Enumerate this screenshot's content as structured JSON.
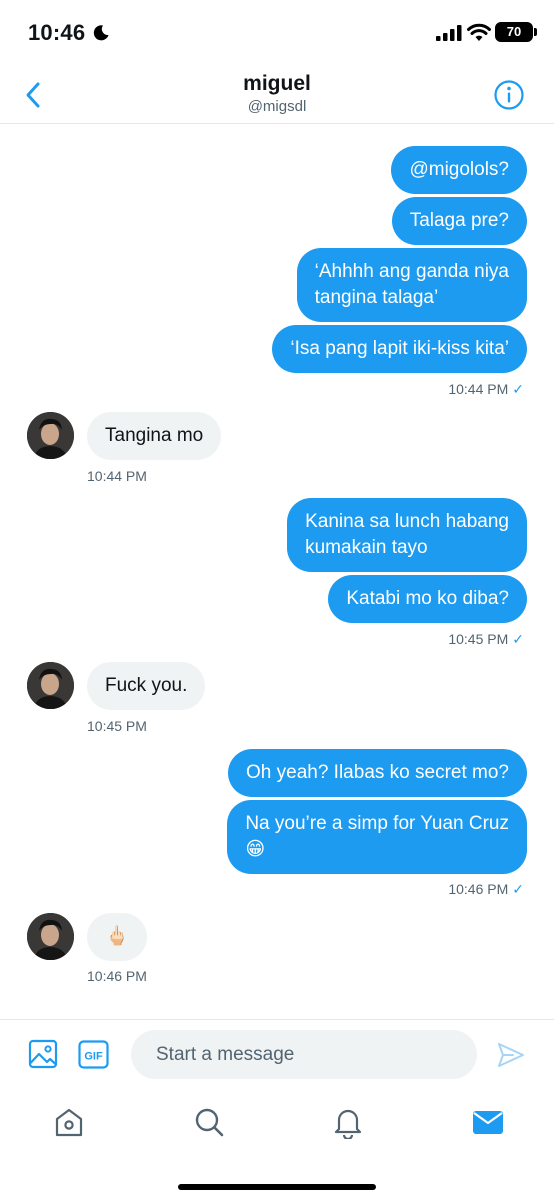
{
  "status_bar": {
    "time": "10:46",
    "battery": "70"
  },
  "header": {
    "name": "miguel",
    "handle": "@migsdl"
  },
  "messages": [
    {
      "text": "@migolols?"
    },
    {
      "text": "Talaga pre?"
    },
    {
      "line1": "‘Ahhhh ang ganda niya",
      "line2": "tangina talaga’"
    },
    {
      "text": "‘Isa pang lapit iki-kiss kita’"
    },
    {
      "time": "10:44 PM",
      "check": "✓"
    },
    {
      "text": "Tangina mo"
    },
    {
      "time": "10:44 PM"
    },
    {
      "line1": "Kanina sa lunch habang",
      "line2": "kumakain tayo"
    },
    {
      "text": "Katabi mo ko diba?"
    },
    {
      "time": "10:45 PM",
      "check": "✓"
    },
    {
      "text": "Fuck you."
    },
    {
      "time": "10:45 PM"
    },
    {
      "text": "Oh yeah? Ilabas ko secret mo?"
    },
    {
      "line1": "Na you’re a simp for Yuan Cruz",
      "line2": "😁"
    },
    {
      "time": "10:46 PM",
      "check": "✓"
    },
    {
      "text": "🖕🏻"
    },
    {
      "time": "10:46 PM"
    }
  ],
  "composer": {
    "placeholder": "Start a message",
    "gif_label": "GIF"
  },
  "colors": {
    "accent": "#1d9bf0",
    "received_bubble": "#eff3f4",
    "muted_text": "#536471"
  }
}
